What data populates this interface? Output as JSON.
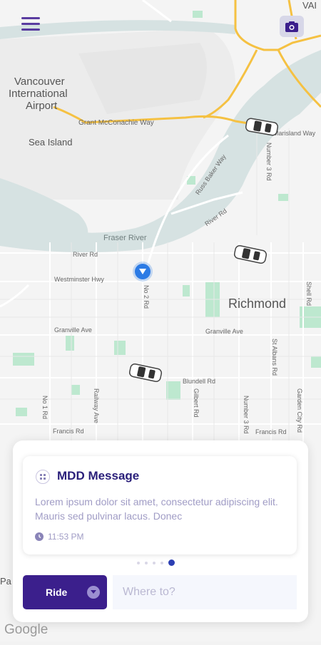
{
  "map": {
    "labels": {
      "vancouver_airport_1": "Vancouver",
      "vancouver_airport_2": "International",
      "vancouver_airport_3": "Airport",
      "sea_island": "Sea Island",
      "grant_mcconachie": "Grant McConachie Way",
      "fraser_river": "Fraser River",
      "richmond": "Richmond",
      "river_rd": "River Rd",
      "westminster_hwy": "Westminster Hwy",
      "granville_ave_1": "Granville Ave",
      "granville_ave_2": "Granville Ave",
      "blundell_rd": "Blundell Rd",
      "francis_rd_1": "Francis Rd",
      "francis_rd_2": "Francis Rd",
      "no2_rd": "No 2 Rd",
      "no1_rd": "No 1 Rd",
      "railway_ave": "Railway Ave",
      "gilbert_rd": "Gilbert Rd",
      "number3_rd": "Number 3 Rd",
      "st_albans_rd": "St Albans Rd",
      "garden_city_rd": "Garden City Rd",
      "river_rd_2": "River Rd",
      "russ_baker_way": "Russ Baker Way",
      "bridgeport_rd": "Number 3 Rd",
      "eburne": "Marisland Way",
      "valley": "VAI",
      "adj_label": "Sea Island",
      "shell_rd": "Shell Rd",
      "pa": "Pa"
    }
  },
  "header": {
    "menu_icon": "hamburger-menu-icon",
    "camera_icon": "camera-icon"
  },
  "message": {
    "title": "MDD Message",
    "body": "Lorem ipsum dolor sit amet, consectetur adipiscing elit. Mauris sed pulvinar lacus. Donec",
    "time": "11:53 PM",
    "carousel_total": 5,
    "carousel_active": 5
  },
  "ride": {
    "label": "Ride",
    "placeholder": "Where to?"
  },
  "footer": {
    "google": "Google"
  },
  "colors": {
    "primary": "#3b1f8c",
    "accent_blue": "#2c7be5",
    "water": "#d9e4e4",
    "park": "#bde8cf",
    "highway": "#f5c142"
  }
}
